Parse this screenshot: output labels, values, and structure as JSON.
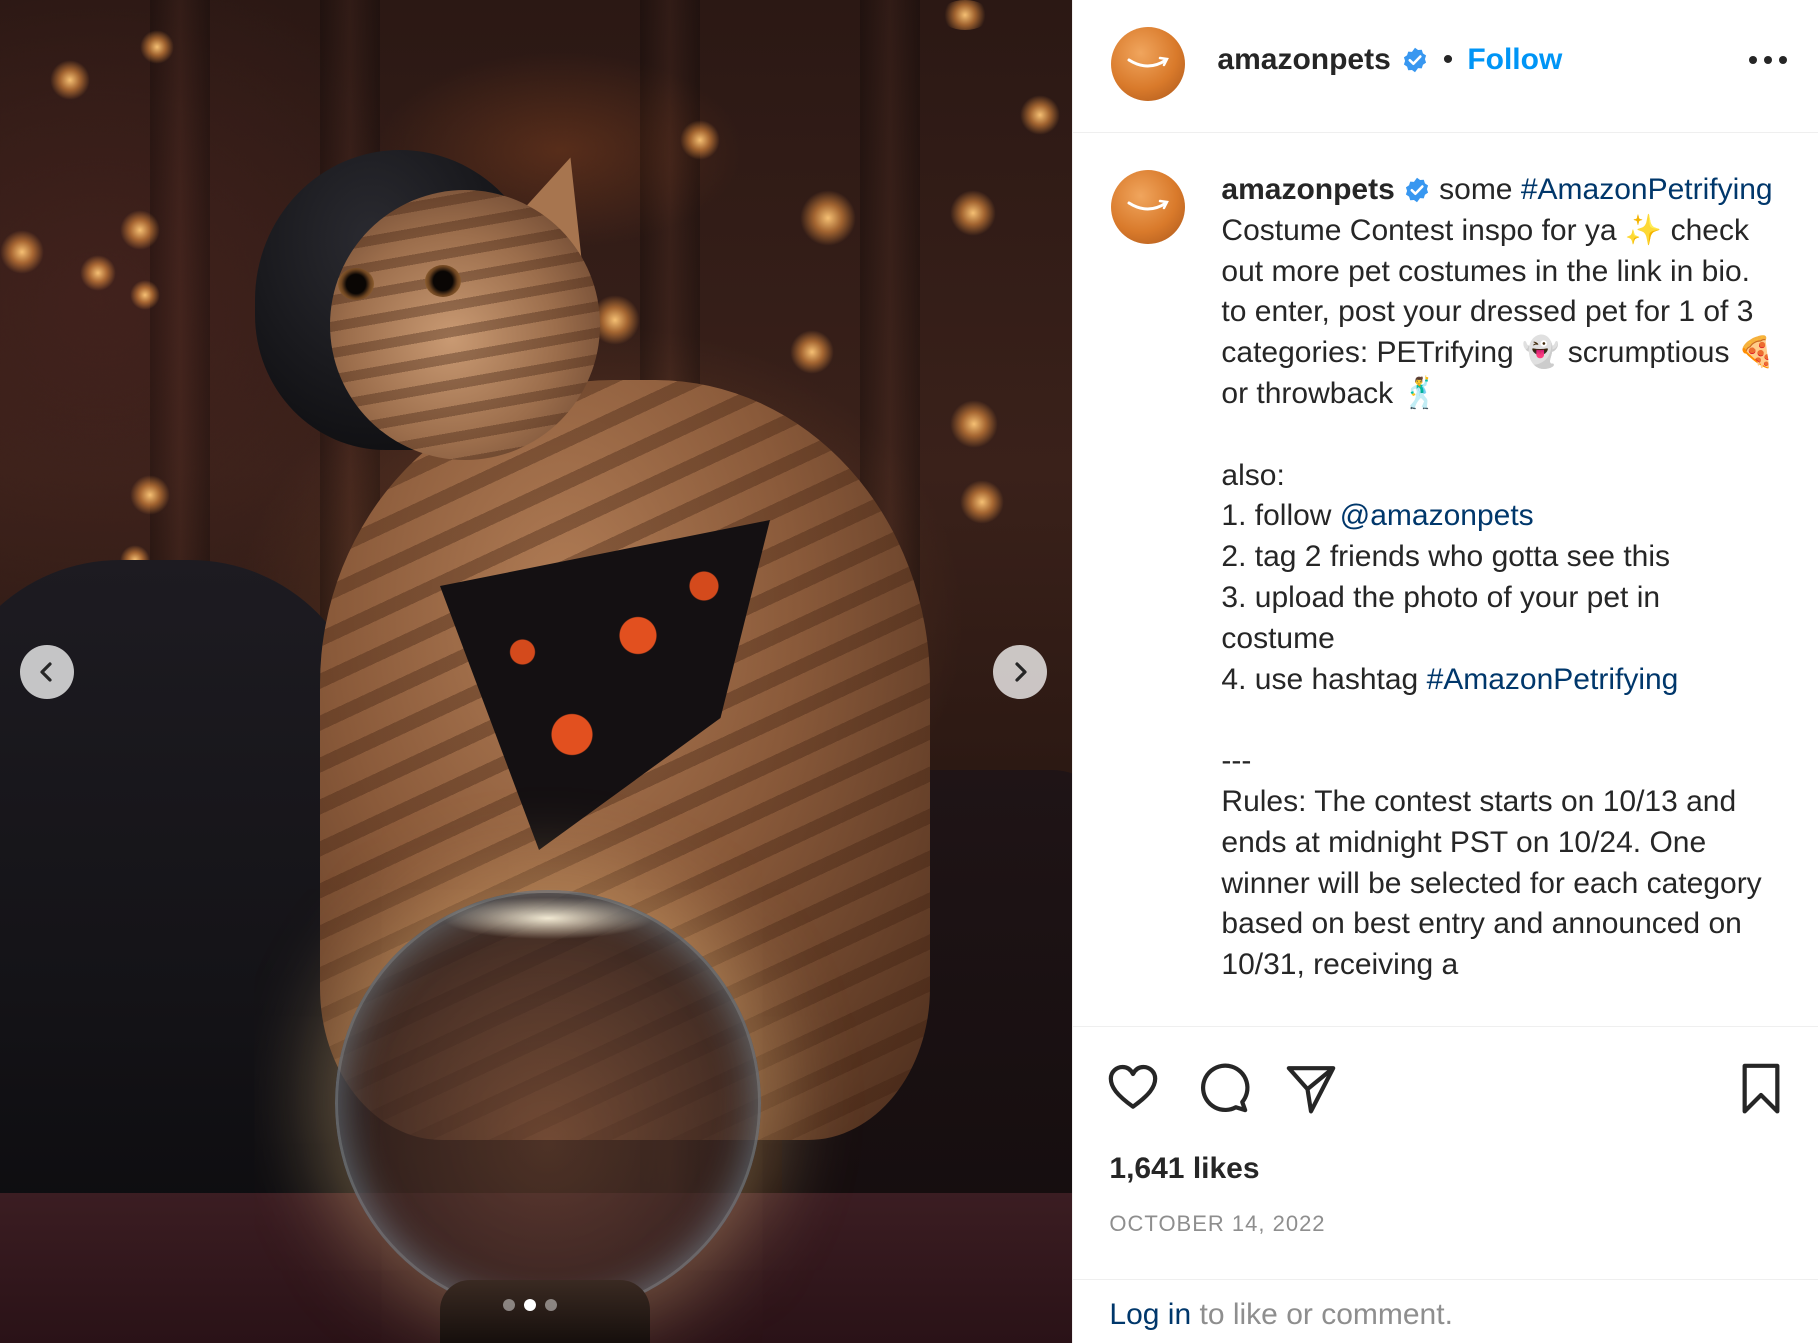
{
  "header": {
    "username": "amazonpets",
    "separator": "•",
    "follow_label": "Follow"
  },
  "caption": {
    "username": "amazonpets",
    "t1": " some ",
    "hashtag1": "#AmazonPetrifying",
    "t2": " Costume Contest inspo for ya ✨ check out more pet costumes in the link in bio. to enter, post your dressed pet for 1 of 3 categories: PETrifying 👻 scrumptious 🍕 or throwback 🕺\n\nalso:\n1. follow ",
    "mention": "@amazonpets",
    "t3": "\n2. tag 2 friends who gotta see this\n3. upload the photo of your pet in costume\n4. use hashtag ",
    "hashtag2": "#AmazonPetrifying",
    "t4": "\n\n---\nRules: The contest starts on 10/13 and ends at midnight PST on 10/24. One winner will be selected for each category based on best entry and announced on 10/31, receiving a"
  },
  "likes": "1,641 likes",
  "date": "OCTOBER 14, 2022",
  "footer": {
    "login_link": "Log in",
    "login_rest": " to like or comment."
  },
  "carousel": {
    "slide_count": 3,
    "active_slide": 2
  },
  "colors": {
    "link_blue": "#0095f6",
    "hashtag_blue": "#00376b",
    "muted": "#8e8e8e",
    "text": "#262626"
  },
  "icons": [
    "heart-icon",
    "comment-icon",
    "share-icon",
    "bookmark-icon",
    "more-icon",
    "verified-icon",
    "chevron-left-icon",
    "chevron-right-icon"
  ]
}
